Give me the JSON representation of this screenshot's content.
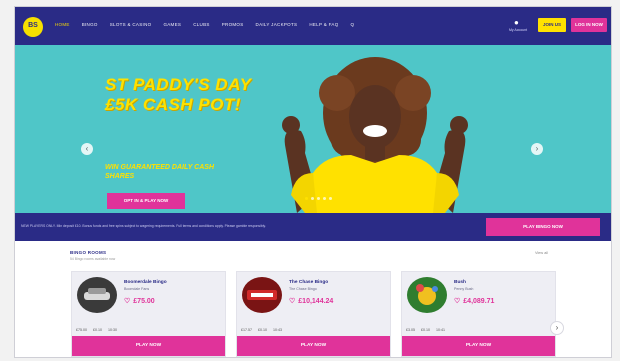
{
  "brand": {
    "logo_text": "BS",
    "accent": "#ffe100",
    "primary": "#2a2b86",
    "pink": "#e0339a",
    "teal": "#4fc6c8"
  },
  "nav": {
    "items": [
      "HOME",
      "BINGO",
      "SLOTS & CASINO",
      "GAMES",
      "CLUBS",
      "PROMOS",
      "DAILY JACKPOTS",
      "HELP & FAQ",
      "Q"
    ],
    "account_label": "My Account",
    "join_label": "JOIN US",
    "login_label": "LOG IN NOW"
  },
  "hero": {
    "title": "ST PADDY'S DAY £5K CASH POT!",
    "subtitle": "WIN GUARANTEED DAILY CASH SHARES",
    "cta": "OPT IN & PLAY NOW",
    "prev_glyph": "‹",
    "next_glyph": "›"
  },
  "infobar": {
    "text": "NEW PLAYERS ONLY. Min deposit £10. Bonus funds and free spins subject to wagering requirements. Full terms and conditions apply. Please gamble responsibly.",
    "cta": "PLAY BINGO NOW"
  },
  "games": {
    "title": "BINGO ROOMS",
    "subtitle": "54 Bingo rooms available now",
    "view_all": "View all",
    "next_glyph": "›",
    "cards": [
      {
        "name": "Boomerdale Bingo",
        "type": "Boomdale Fans",
        "jackpot": "£75.00",
        "meta": [
          "£75.00",
          "£0.10",
          "10:30"
        ],
        "play": "PLAY NOW"
      },
      {
        "name": "The Chase Bingo",
        "type": "The Chase Bingo",
        "jackpot": "£10,144.24",
        "meta": [
          "£17.57",
          "£0.10",
          "10:43"
        ],
        "play": "PLAY NOW"
      },
      {
        "name": "Bush",
        "type": "Penny Bush",
        "jackpot": "£4,089.71",
        "meta": [
          "£3.05",
          "£0.10",
          "10:41"
        ],
        "play": "PLAY NOW"
      }
    ]
  }
}
